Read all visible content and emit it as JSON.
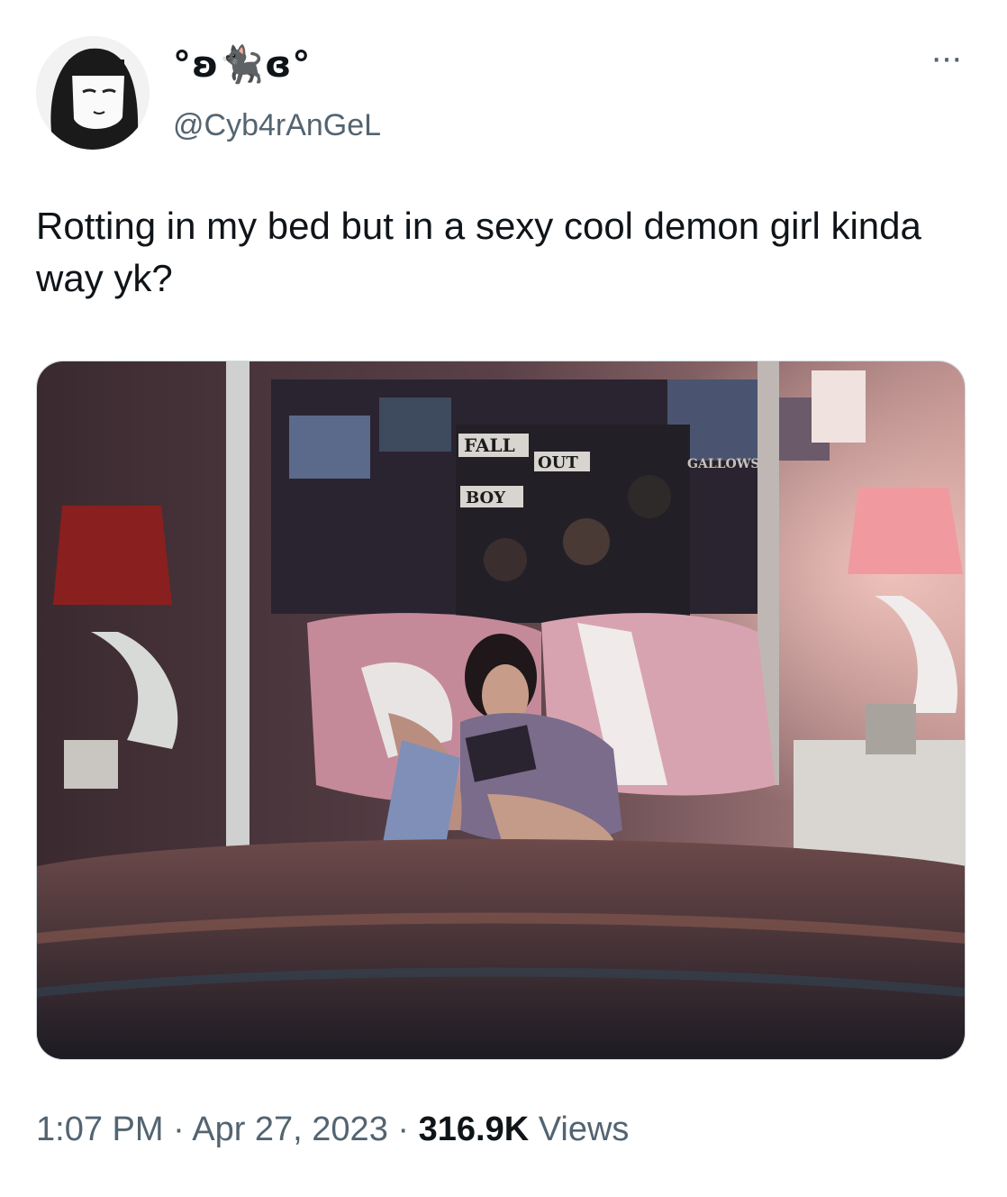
{
  "user": {
    "display_name": "°ʚ🐈‍⬛ɞ°",
    "handle": "@Cyb4rAnGeL",
    "avatar_icon": "avatar-illustration"
  },
  "more_icon": "more-horizontal-icon",
  "more_label": "···",
  "tweet": {
    "text": "Rotting in my bed but in a sexy cool demon girl kinda way yk?"
  },
  "media": {
    "poster_text": [
      "FALL",
      "OUT",
      "BOY"
    ],
    "poster_small_text": "GALLOWS"
  },
  "meta": {
    "time": "1:07 PM",
    "separator": " · ",
    "date": "Apr 27, 2023",
    "separator2": " · ",
    "views_count": "316.9K",
    "views_label": " Views"
  },
  "colors": {
    "text_primary": "#0f1419",
    "text_secondary": "#536471",
    "border": "#cfd9de"
  }
}
